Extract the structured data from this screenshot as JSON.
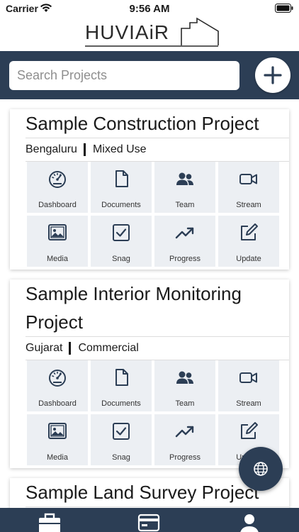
{
  "status_bar": {
    "carrier": "Carrier",
    "time": "9:56 AM"
  },
  "app": {
    "logo_text": "HUVIAiR"
  },
  "search": {
    "placeholder": "Search Projects"
  },
  "projects": [
    {
      "title": "Sample Construction Project",
      "location": "Bengaluru",
      "category": "Mixed Use"
    },
    {
      "title": "Sample Interior Monitoring Project",
      "location": "Gujarat",
      "category": "Commercial"
    },
    {
      "title": "Sample Land Survey Project"
    }
  ],
  "tiles": [
    {
      "label": "Dashboard",
      "icon": "dashboard-gauge-icon"
    },
    {
      "label": "Documents",
      "icon": "document-icon"
    },
    {
      "label": "Team",
      "icon": "team-icon"
    },
    {
      "label": "Stream",
      "icon": "video-camera-icon"
    },
    {
      "label": "Media",
      "icon": "image-icon"
    },
    {
      "label": "Snag",
      "icon": "checkbox-icon"
    },
    {
      "label": "Progress",
      "icon": "trending-up-icon"
    },
    {
      "label": "Update",
      "icon": "edit-icon"
    }
  ],
  "colors": {
    "primary": "#2c3e55",
    "tile_bg": "#eceff3",
    "icon": "#2c3e55"
  }
}
